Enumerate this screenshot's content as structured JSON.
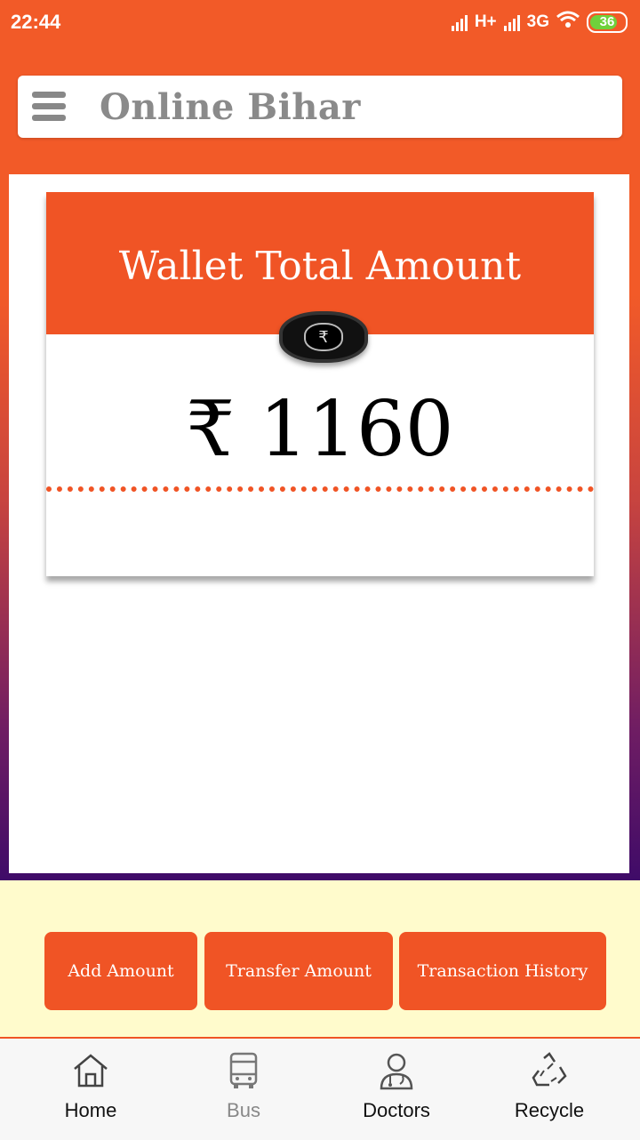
{
  "status_bar": {
    "time": "22:44",
    "network_1": "H+",
    "network_2": "3G",
    "battery": "36"
  },
  "header": {
    "app_title": "Online Bihar",
    "menu_icon": "hamburger-icon"
  },
  "wallet": {
    "title": "Wallet Total Amount",
    "amount": "₹ 1160",
    "coin_icon": "rupee-coin-icon"
  },
  "actions": {
    "add_amount": "Add Amount",
    "transfer_amount": "Transfer Amount",
    "transaction_history": "Transaction History"
  },
  "bottom_nav": {
    "items": [
      {
        "label": "Home",
        "icon": "home-icon"
      },
      {
        "label": "Bus",
        "icon": "bus-icon"
      },
      {
        "label": "Doctors",
        "icon": "doctor-icon"
      },
      {
        "label": "Recycle",
        "icon": "recycle-icon"
      }
    ]
  },
  "colors": {
    "accent": "#f05425",
    "header_bg": "#f25a28",
    "gradient_end": "#3f0b68",
    "action_area_bg": "#fffbcc"
  }
}
